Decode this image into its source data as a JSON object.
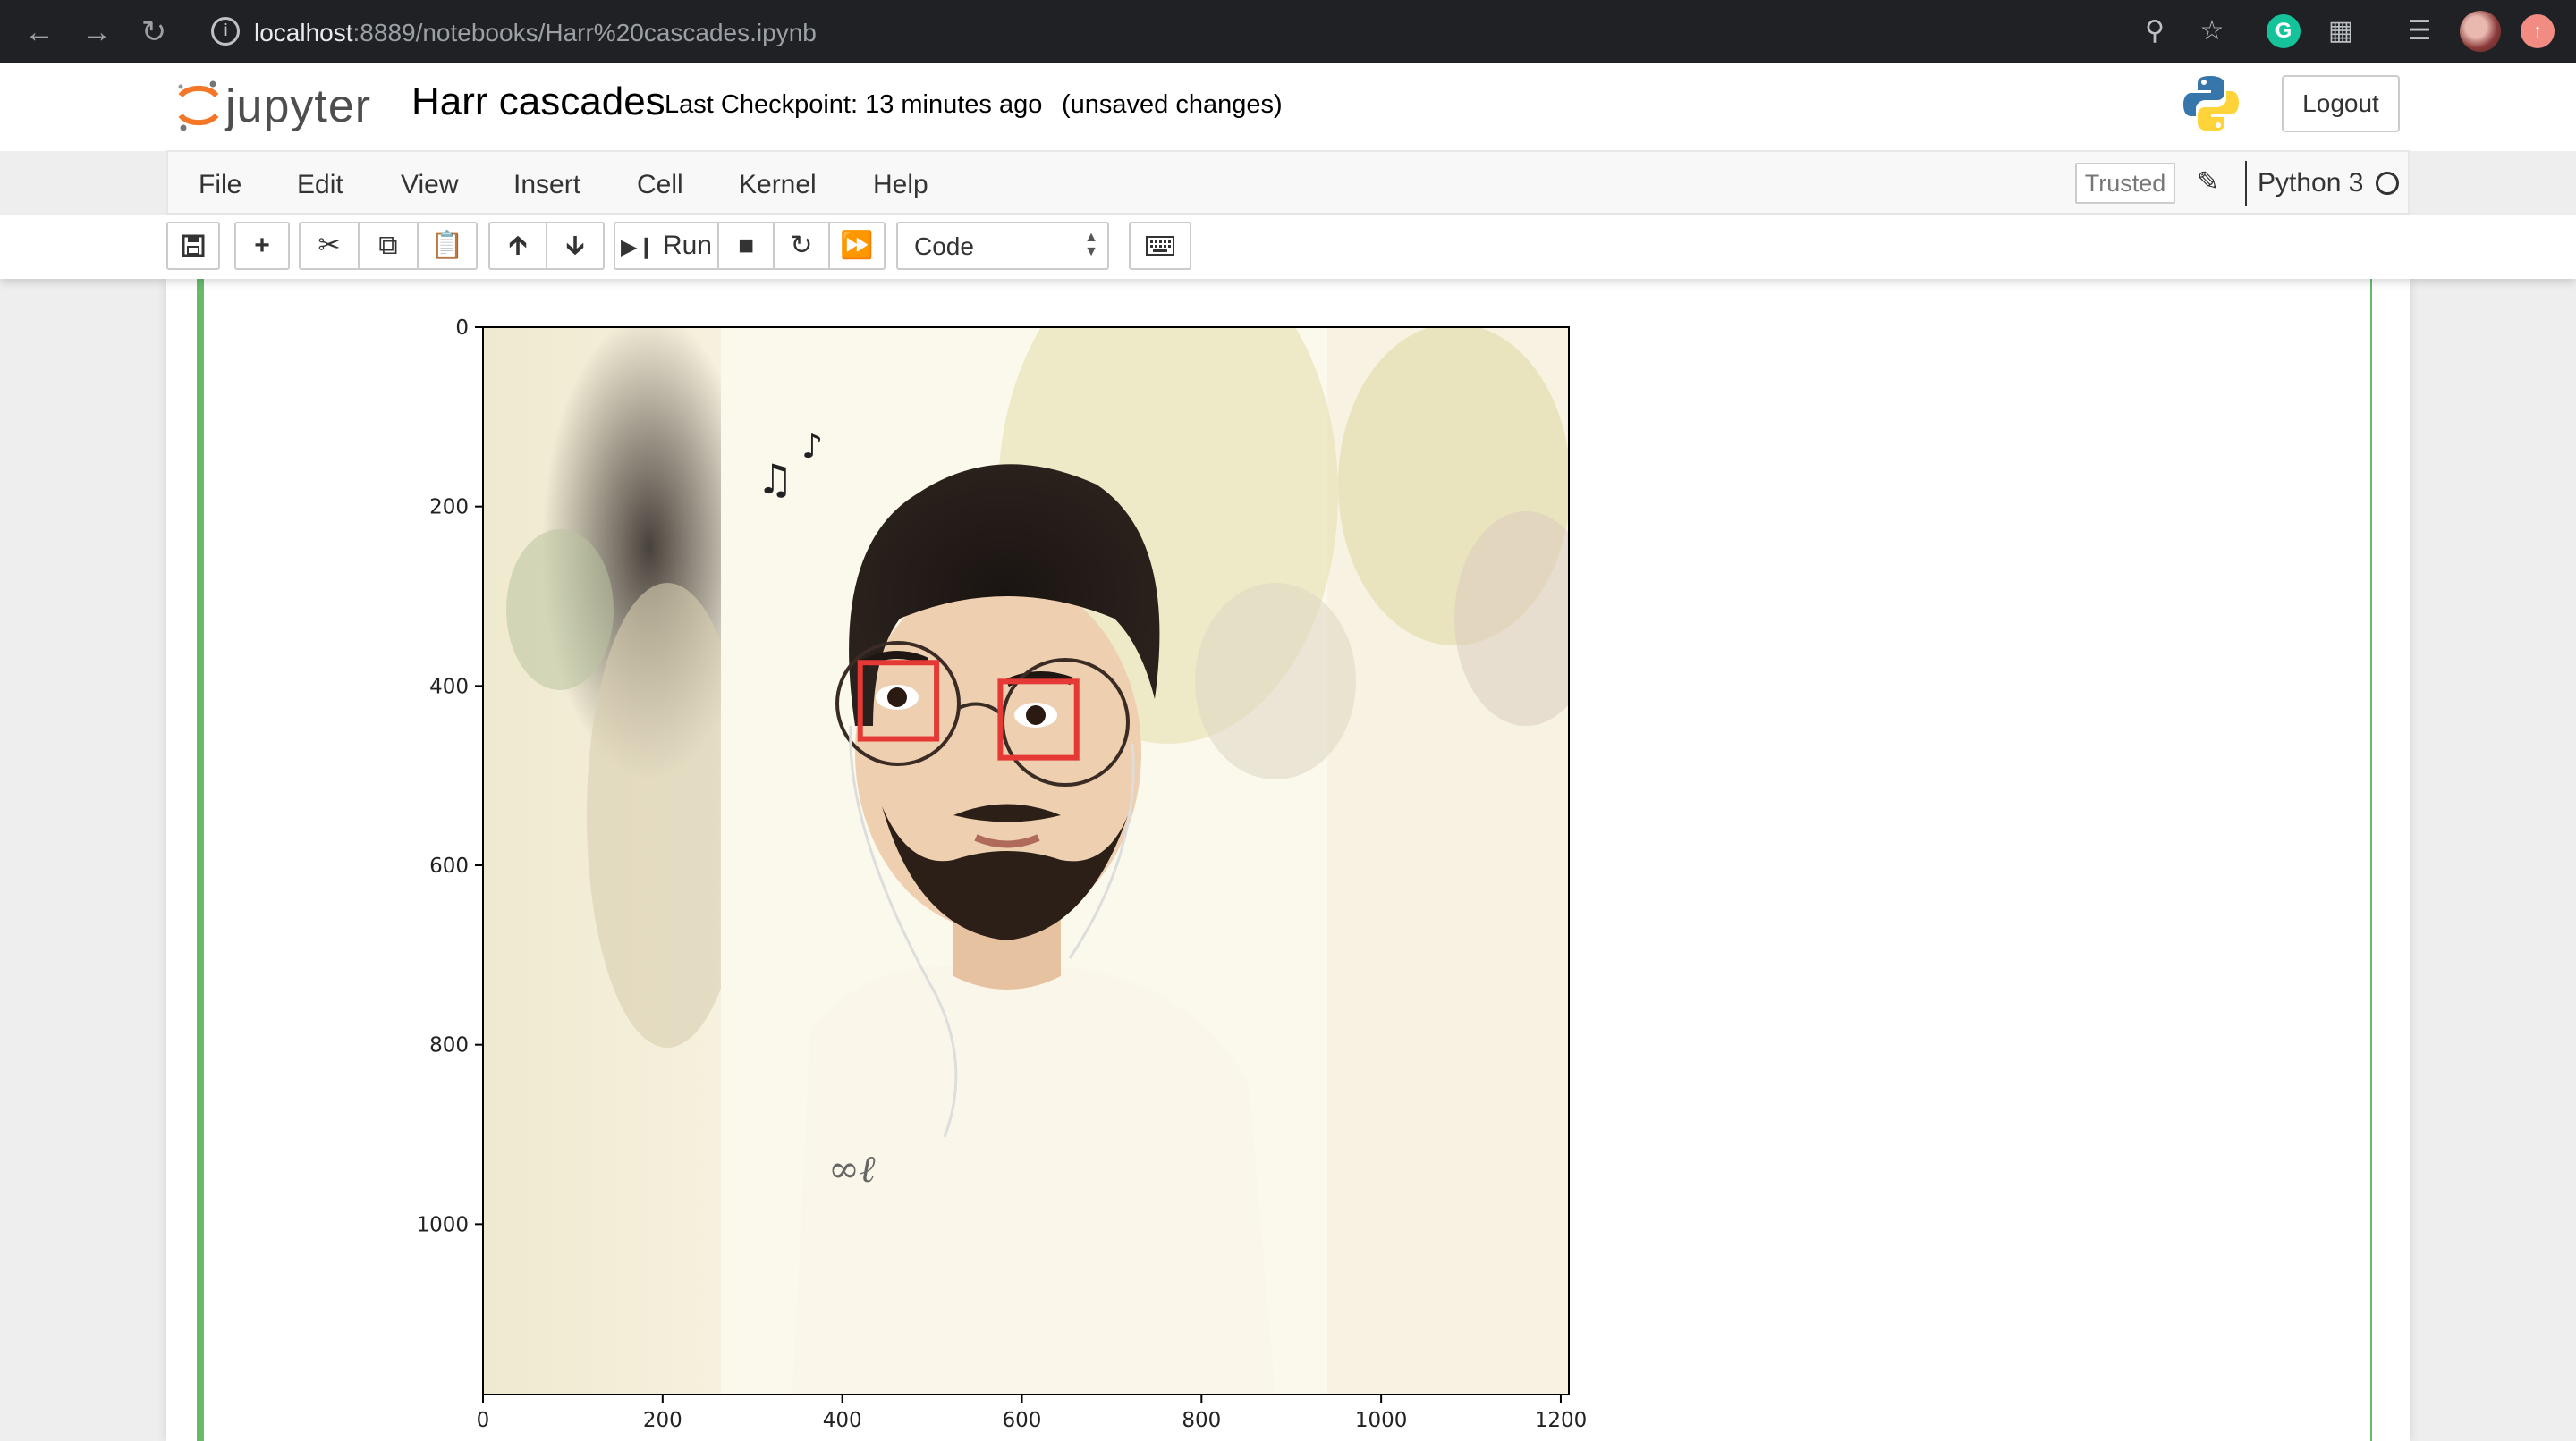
{
  "browser": {
    "url_host": "localhost",
    "url_path": ":8889/notebooks/Harr%20cascades.ipynb"
  },
  "header": {
    "logo_text": "jupyter",
    "notebook_name": "Harr cascades",
    "checkpoint": "Last Checkpoint: 13 minutes ago",
    "autosave_status": "(unsaved changes)",
    "logout_label": "Logout"
  },
  "menubar": {
    "items": [
      "File",
      "Edit",
      "View",
      "Insert",
      "Cell",
      "Kernel",
      "Help"
    ],
    "trusted_label": "Trusted",
    "kernel_name": "Python 3"
  },
  "toolbar": {
    "run_label": "Run",
    "cell_type": "Code"
  },
  "colors": {
    "cell_border": "#66bb6a",
    "detection_box": "#e53935"
  },
  "chart_data": {
    "type": "image",
    "x_ticks": [
      "0",
      "200",
      "400",
      "600",
      "800",
      "1000",
      "1200"
    ],
    "y_ticks": [
      "0",
      "200",
      "400",
      "600",
      "800",
      "1000"
    ],
    "xlim": [
      0,
      1209
    ],
    "ylim": [
      1190,
      0
    ],
    "detections": [
      {
        "label": "eye",
        "x": 420,
        "y": 374,
        "w": 85,
        "h": 85
      },
      {
        "label": "eye",
        "x": 576,
        "y": 395,
        "w": 85,
        "h": 85
      }
    ]
  }
}
